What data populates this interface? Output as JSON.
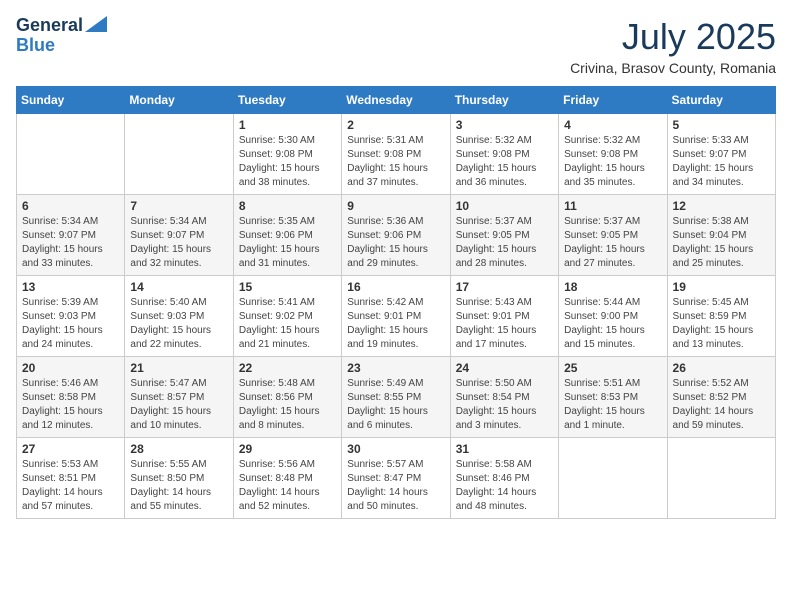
{
  "logo": {
    "line1": "General",
    "line2": "Blue"
  },
  "title": {
    "month_year": "July 2025",
    "location": "Crivina, Brasov County, Romania"
  },
  "weekdays": [
    "Sunday",
    "Monday",
    "Tuesday",
    "Wednesday",
    "Thursday",
    "Friday",
    "Saturday"
  ],
  "weeks": [
    [
      {
        "day": "",
        "info": ""
      },
      {
        "day": "",
        "info": ""
      },
      {
        "day": "1",
        "info": "Sunrise: 5:30 AM\nSunset: 9:08 PM\nDaylight: 15 hours\nand 38 minutes."
      },
      {
        "day": "2",
        "info": "Sunrise: 5:31 AM\nSunset: 9:08 PM\nDaylight: 15 hours\nand 37 minutes."
      },
      {
        "day": "3",
        "info": "Sunrise: 5:32 AM\nSunset: 9:08 PM\nDaylight: 15 hours\nand 36 minutes."
      },
      {
        "day": "4",
        "info": "Sunrise: 5:32 AM\nSunset: 9:08 PM\nDaylight: 15 hours\nand 35 minutes."
      },
      {
        "day": "5",
        "info": "Sunrise: 5:33 AM\nSunset: 9:07 PM\nDaylight: 15 hours\nand 34 minutes."
      }
    ],
    [
      {
        "day": "6",
        "info": "Sunrise: 5:34 AM\nSunset: 9:07 PM\nDaylight: 15 hours\nand 33 minutes."
      },
      {
        "day": "7",
        "info": "Sunrise: 5:34 AM\nSunset: 9:07 PM\nDaylight: 15 hours\nand 32 minutes."
      },
      {
        "day": "8",
        "info": "Sunrise: 5:35 AM\nSunset: 9:06 PM\nDaylight: 15 hours\nand 31 minutes."
      },
      {
        "day": "9",
        "info": "Sunrise: 5:36 AM\nSunset: 9:06 PM\nDaylight: 15 hours\nand 29 minutes."
      },
      {
        "day": "10",
        "info": "Sunrise: 5:37 AM\nSunset: 9:05 PM\nDaylight: 15 hours\nand 28 minutes."
      },
      {
        "day": "11",
        "info": "Sunrise: 5:37 AM\nSunset: 9:05 PM\nDaylight: 15 hours\nand 27 minutes."
      },
      {
        "day": "12",
        "info": "Sunrise: 5:38 AM\nSunset: 9:04 PM\nDaylight: 15 hours\nand 25 minutes."
      }
    ],
    [
      {
        "day": "13",
        "info": "Sunrise: 5:39 AM\nSunset: 9:03 PM\nDaylight: 15 hours\nand 24 minutes."
      },
      {
        "day": "14",
        "info": "Sunrise: 5:40 AM\nSunset: 9:03 PM\nDaylight: 15 hours\nand 22 minutes."
      },
      {
        "day": "15",
        "info": "Sunrise: 5:41 AM\nSunset: 9:02 PM\nDaylight: 15 hours\nand 21 minutes."
      },
      {
        "day": "16",
        "info": "Sunrise: 5:42 AM\nSunset: 9:01 PM\nDaylight: 15 hours\nand 19 minutes."
      },
      {
        "day": "17",
        "info": "Sunrise: 5:43 AM\nSunset: 9:01 PM\nDaylight: 15 hours\nand 17 minutes."
      },
      {
        "day": "18",
        "info": "Sunrise: 5:44 AM\nSunset: 9:00 PM\nDaylight: 15 hours\nand 15 minutes."
      },
      {
        "day": "19",
        "info": "Sunrise: 5:45 AM\nSunset: 8:59 PM\nDaylight: 15 hours\nand 13 minutes."
      }
    ],
    [
      {
        "day": "20",
        "info": "Sunrise: 5:46 AM\nSunset: 8:58 PM\nDaylight: 15 hours\nand 12 minutes."
      },
      {
        "day": "21",
        "info": "Sunrise: 5:47 AM\nSunset: 8:57 PM\nDaylight: 15 hours\nand 10 minutes."
      },
      {
        "day": "22",
        "info": "Sunrise: 5:48 AM\nSunset: 8:56 PM\nDaylight: 15 hours\nand 8 minutes."
      },
      {
        "day": "23",
        "info": "Sunrise: 5:49 AM\nSunset: 8:55 PM\nDaylight: 15 hours\nand 6 minutes."
      },
      {
        "day": "24",
        "info": "Sunrise: 5:50 AM\nSunset: 8:54 PM\nDaylight: 15 hours\nand 3 minutes."
      },
      {
        "day": "25",
        "info": "Sunrise: 5:51 AM\nSunset: 8:53 PM\nDaylight: 15 hours\nand 1 minute."
      },
      {
        "day": "26",
        "info": "Sunrise: 5:52 AM\nSunset: 8:52 PM\nDaylight: 14 hours\nand 59 minutes."
      }
    ],
    [
      {
        "day": "27",
        "info": "Sunrise: 5:53 AM\nSunset: 8:51 PM\nDaylight: 14 hours\nand 57 minutes."
      },
      {
        "day": "28",
        "info": "Sunrise: 5:55 AM\nSunset: 8:50 PM\nDaylight: 14 hours\nand 55 minutes."
      },
      {
        "day": "29",
        "info": "Sunrise: 5:56 AM\nSunset: 8:48 PM\nDaylight: 14 hours\nand 52 minutes."
      },
      {
        "day": "30",
        "info": "Sunrise: 5:57 AM\nSunset: 8:47 PM\nDaylight: 14 hours\nand 50 minutes."
      },
      {
        "day": "31",
        "info": "Sunrise: 5:58 AM\nSunset: 8:46 PM\nDaylight: 14 hours\nand 48 minutes."
      },
      {
        "day": "",
        "info": ""
      },
      {
        "day": "",
        "info": ""
      }
    ]
  ]
}
